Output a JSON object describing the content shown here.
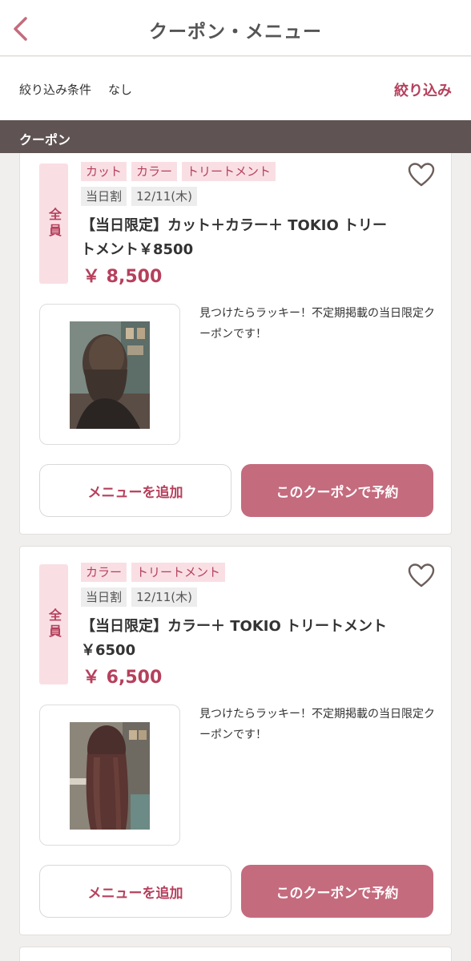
{
  "header": {
    "title": "クーポン・メニュー",
    "back_icon": "chevron-left-icon"
  },
  "filter": {
    "label": "絞り込み条件",
    "value": "なし",
    "button_label": "絞り込み"
  },
  "section": {
    "title": "クーポン"
  },
  "colors": {
    "accent": "#b6405c",
    "book_button": "#c56b7e",
    "section_bar": "#5f5453",
    "tag_bg": "#f9dfe4"
  },
  "coupons": [
    {
      "target": "全員",
      "tags": [
        "カット",
        "カラー",
        "トリートメント"
      ],
      "subtags": [
        "当日割",
        "12/11(木)"
      ],
      "title": "【当日限定】カット＋カラー＋ TOKIO トリートメント￥8500",
      "price": "￥ 8,500",
      "description": "見つけたらラッキー！不定期掲載の当日限定クーポンです！",
      "add_label": "メニューを追加",
      "book_label": "このクーポンで予約"
    },
    {
      "target": "全員",
      "tags": [
        "カラー",
        "トリートメント"
      ],
      "subtags": [
        "当日割",
        "12/11(木)"
      ],
      "title": "【当日限定】カラー＋ TOKIO トリートメント￥6500",
      "price": "￥ 6,500",
      "description": "見つけたらラッキー！不定期掲載の当日限定クーポンです！",
      "add_label": "メニューを追加",
      "book_label": "このクーポンで予約"
    }
  ]
}
